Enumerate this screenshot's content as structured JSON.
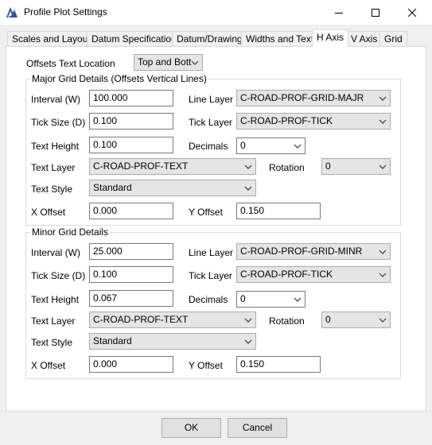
{
  "window": {
    "title": "Profile Plot Settings",
    "icon": "app-logo-icon",
    "accent_color": "#2b579a"
  },
  "tabs": [
    {
      "label": "Scales and Layout"
    },
    {
      "label": "Datum Specification"
    },
    {
      "label": "Datum/Drawing"
    },
    {
      "label": "Widths and Text"
    },
    {
      "label": "H Axis",
      "active": true
    },
    {
      "label": "V Axis"
    },
    {
      "label": "Grid"
    }
  ],
  "offsets_text_location": {
    "label": "Offsets Text Location",
    "value": "Top and Bott"
  },
  "major": {
    "title": "Major Grid Details (Offsets Vertical Lines)",
    "interval_label": "Interval (W)",
    "interval": "100.000",
    "line_layer_label": "Line Layer",
    "line_layer": "C-ROAD-PROF-GRID-MAJR",
    "tick_size_label": "Tick Size (D)",
    "tick_size": "0.100",
    "tick_layer_label": "Tick Layer",
    "tick_layer": "C-ROAD-PROF-TICK",
    "text_height_label": "Text Height",
    "text_height": "0.100",
    "decimals_label": "Decimals",
    "decimals": "0",
    "text_layer_label": "Text Layer",
    "text_layer": "C-ROAD-PROF-TEXT",
    "rotation_label": "Rotation",
    "rotation": "0",
    "text_style_label": "Text Style",
    "text_style": "Standard",
    "x_offset_label": "X Offset",
    "x_offset": "0.000",
    "y_offset_label": "Y Offset",
    "y_offset": "0.150"
  },
  "minor": {
    "title": "Minor Grid Details",
    "interval_label": "Interval (W)",
    "interval": "25.000",
    "line_layer_label": "Line Layer",
    "line_layer": "C-ROAD-PROF-GRID-MINR",
    "tick_size_label": "Tick Size (D)",
    "tick_size": "0.100",
    "tick_layer_label": "Tick Layer",
    "tick_layer": "C-ROAD-PROF-TICK",
    "text_height_label": "Text Height",
    "text_height": "0.067",
    "decimals_label": "Decimals",
    "decimals": "0",
    "text_layer_label": "Text Layer",
    "text_layer": "C-ROAD-PROF-TEXT",
    "rotation_label": "Rotation",
    "rotation": "0",
    "text_style_label": "Text Style",
    "text_style": "Standard",
    "x_offset_label": "X Offset",
    "x_offset": "0.000",
    "y_offset_label": "Y Offset",
    "y_offset": "0.150"
  },
  "buttons": {
    "ok": "OK",
    "cancel": "Cancel"
  }
}
